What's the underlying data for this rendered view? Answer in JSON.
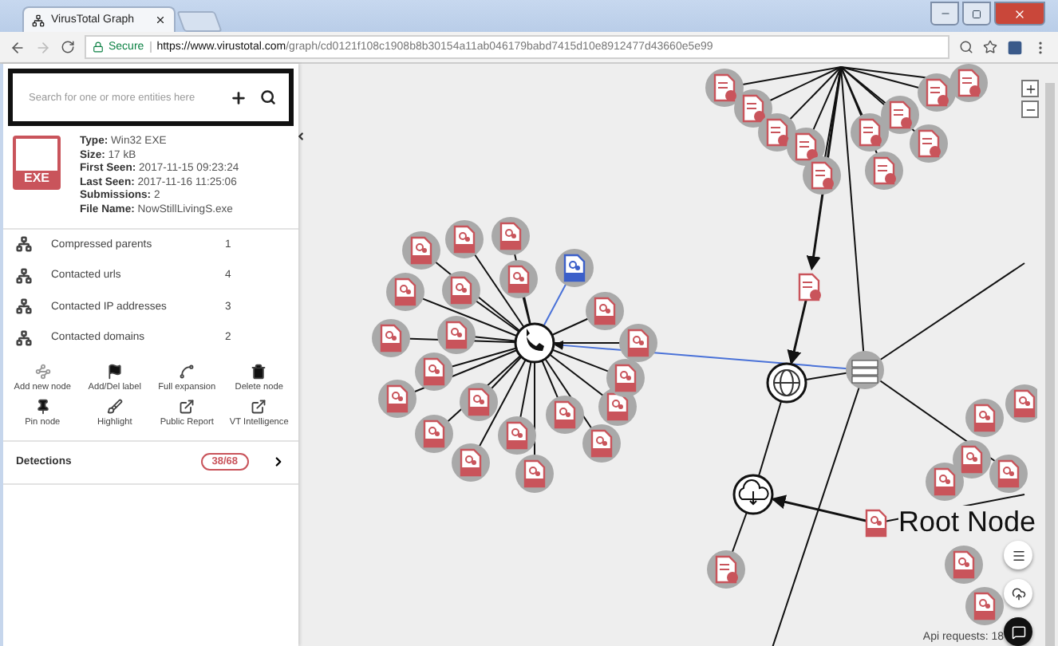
{
  "browser": {
    "tab_title": "VirusTotal Graph",
    "secure_label": "Secure",
    "url_host": "https://www.virustotal.com",
    "url_path": "/graph/cd0121f108c1908b8b30154a11ab046179babd7415d10e8912477d43660e5e99"
  },
  "sidebar": {
    "search": {
      "placeholder": "Search for one or more entities here"
    },
    "file_info": [
      {
        "label": "Type:",
        "value": "Win32 EXE"
      },
      {
        "label": "Size:",
        "value": "17 kB"
      },
      {
        "label": "First Seen:",
        "value": "2017-11-15 09:23:24"
      },
      {
        "label": "Last Seen:",
        "value": "2017-11-16 11:25:06"
      },
      {
        "label": "Submissions:",
        "value": "2"
      },
      {
        "label": "File Name:",
        "value": "NowStillLivingS.exe"
      }
    ],
    "file_icon_label": "EXE",
    "relations": [
      {
        "label": "Compressed parents",
        "count": "1"
      },
      {
        "label": "Contacted urls",
        "count": "4"
      },
      {
        "label": "Contacted IP addresses",
        "count": "3"
      },
      {
        "label": "Contacted domains",
        "count": "2"
      }
    ],
    "actions": [
      {
        "kind": "add",
        "label": "Add new node"
      },
      {
        "kind": "flag",
        "label": "Add/Del label"
      },
      {
        "kind": "expand",
        "label": "Full expansion"
      },
      {
        "kind": "delete",
        "label": "Delete node"
      },
      {
        "kind": "pin",
        "label": "Pin node"
      },
      {
        "kind": "highlight",
        "label": "Highlight"
      },
      {
        "kind": "external",
        "label": "Public Report"
      },
      {
        "kind": "external",
        "label": "VT Intelligence"
      }
    ],
    "detections": {
      "label": "Detections",
      "ratio": "38/68"
    }
  },
  "graph": {
    "root_label": "Root Node",
    "api_requests": "Api requests: 18"
  }
}
